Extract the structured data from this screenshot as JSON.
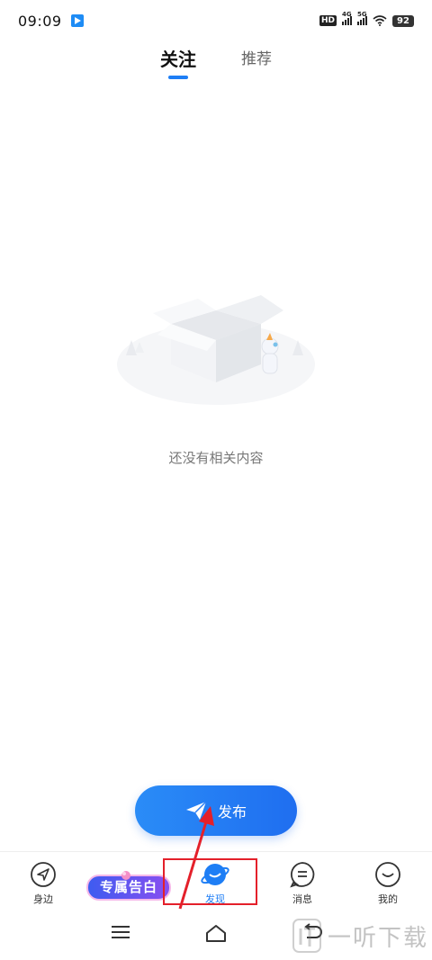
{
  "status_bar": {
    "time": "09:09",
    "hd_label": "HD",
    "network_1": "4G",
    "network_2": "5G",
    "battery": "92"
  },
  "top_tabs": [
    {
      "label": "关注",
      "active": true
    },
    {
      "label": "推荐",
      "active": false
    }
  ],
  "empty_state": {
    "message": "还没有相关内容",
    "icon": "empty-box-illustration"
  },
  "publish_button": {
    "label": "发布",
    "icon": "paper-plane-icon"
  },
  "promo_badge": {
    "text": "专属告白"
  },
  "bottom_tabs": [
    {
      "label": "身边",
      "icon": "location-arrow-icon"
    },
    {
      "label": "发现",
      "icon": "planet-icon",
      "active": true
    },
    {
      "label": "消息",
      "icon": "chat-bubble-icon"
    },
    {
      "label": "我的",
      "icon": "face-icon"
    }
  ],
  "system_nav": [
    "menu-icon",
    "home-icon",
    "back-icon"
  ],
  "watermark": {
    "text": "一听下载"
  },
  "colors": {
    "accent": "#1e7ef5",
    "annotation_red": "#e4202a"
  }
}
